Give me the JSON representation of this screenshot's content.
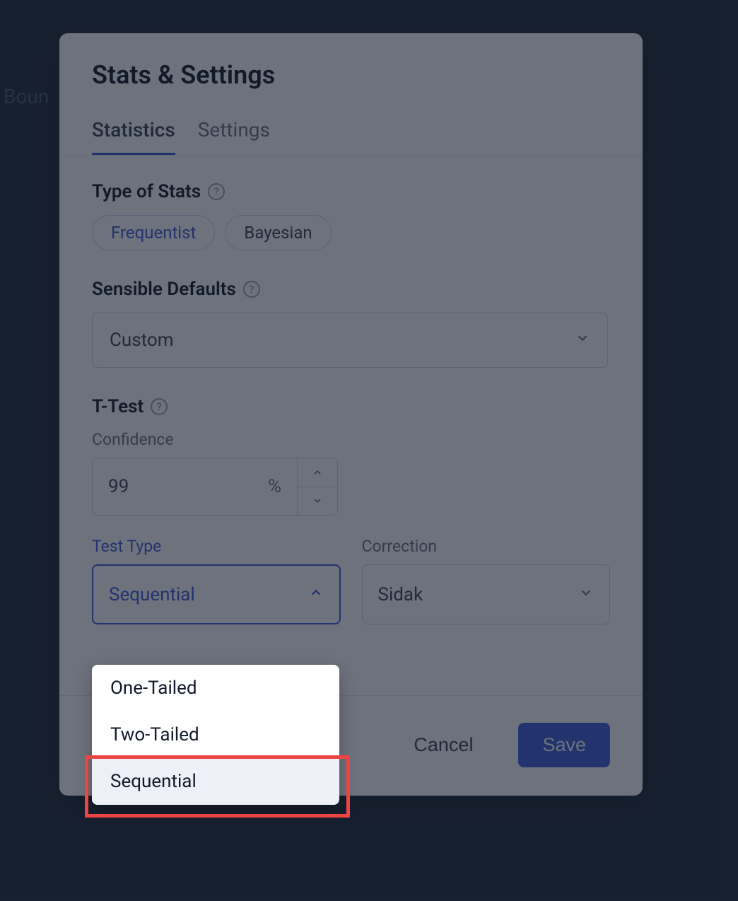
{
  "background_text": "Boun",
  "modal": {
    "title": "Stats & Settings",
    "tabs": [
      "Statistics",
      "Settings"
    ],
    "active_tab": "Statistics",
    "type_of_stats": {
      "label": "Type of Stats",
      "options": [
        "Frequentist",
        "Bayesian"
      ],
      "selected": "Frequentist"
    },
    "sensible_defaults": {
      "label": "Sensible Defaults",
      "value": "Custom"
    },
    "ttest": {
      "label": "T-Test",
      "confidence_label": "Confidence",
      "confidence_value": "99",
      "confidence_unit": "%",
      "test_type": {
        "label": "Test Type",
        "value": "Sequential",
        "options": [
          "One-Tailed",
          "Two-Tailed",
          "Sequential"
        ]
      },
      "correction": {
        "label": "Correction",
        "value": "Sidak"
      }
    },
    "footer": {
      "cancel": "Cancel",
      "save": "Save"
    }
  }
}
